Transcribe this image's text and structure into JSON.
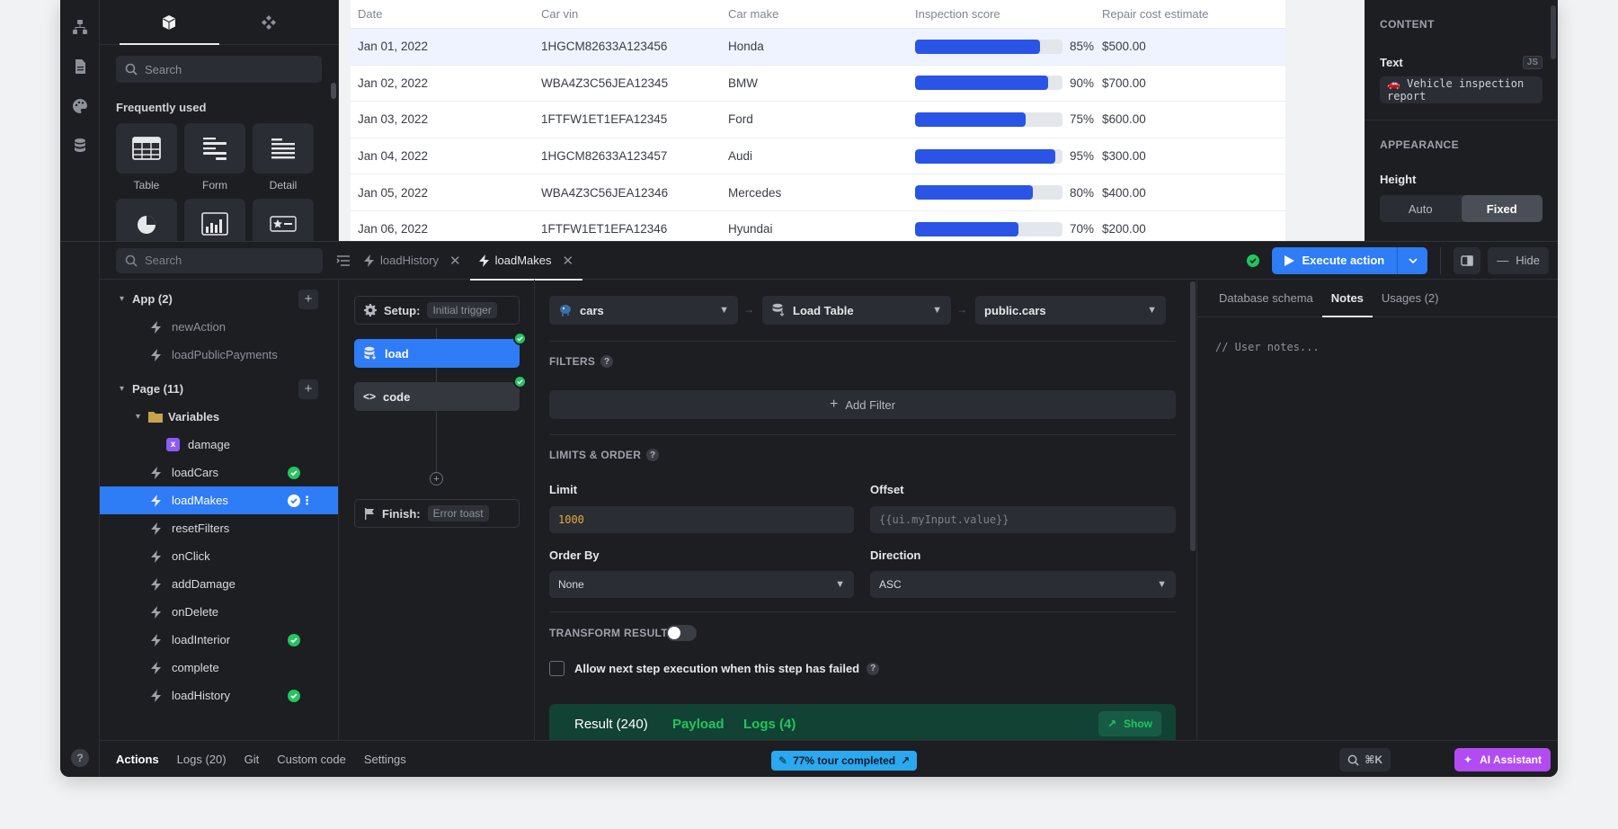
{
  "widgets": {
    "search_placeholder": "Search",
    "section_title": "Frequently used",
    "items": [
      {
        "label": "Table",
        "icon": "table-icon"
      },
      {
        "label": "Form",
        "icon": "form-icon"
      },
      {
        "label": "Detail",
        "icon": "detail-icon"
      },
      {
        "label": "",
        "icon": "pie-chart-icon"
      },
      {
        "label": "",
        "icon": "bar-chart-icon"
      },
      {
        "label": "",
        "icon": "rating-icon"
      }
    ]
  },
  "grid": {
    "columns": [
      "Date",
      "Car vin",
      "Car make",
      "Inspection score",
      "Repair cost estimate"
    ],
    "rows": [
      {
        "date": "Jan 01, 2022",
        "vin": "1HGCM82633A123456",
        "make": "Honda",
        "score": 85,
        "score_label": "85%",
        "cost": "$500.00"
      },
      {
        "date": "Jan 02, 2022",
        "vin": "WBA4Z3C56JEA12345",
        "make": "BMW",
        "score": 90,
        "score_label": "90%",
        "cost": "$700.00"
      },
      {
        "date": "Jan 03, 2022",
        "vin": "1FTFW1ET1EFA12345",
        "make": "Ford",
        "score": 75,
        "score_label": "75%",
        "cost": "$600.00"
      },
      {
        "date": "Jan 04, 2022",
        "vin": "1HGCM82633A123457",
        "make": "Audi",
        "score": 95,
        "score_label": "95%",
        "cost": "$300.00"
      },
      {
        "date": "Jan 05, 2022",
        "vin": "WBA4Z3C56JEA12346",
        "make": "Mercedes",
        "score": 80,
        "score_label": "80%",
        "cost": "$400.00"
      },
      {
        "date": "Jan 06, 2022",
        "vin": "1FTFW1ET1EFA12346",
        "make": "Hyundai",
        "score": 70,
        "score_label": "70%",
        "cost": "$200.00"
      }
    ]
  },
  "props": {
    "content_title": "CONTENT",
    "text_label": "Text",
    "js_badge": "JS",
    "text_value": "🚗 Vehicle inspection report",
    "appearance_title": "APPEARANCE",
    "height_label": "Height",
    "height_auto": "Auto",
    "height_fixed": "Fixed"
  },
  "actions_bar": {
    "search_placeholder": "Search",
    "tabs": [
      {
        "label": "loadHistory",
        "active": false
      },
      {
        "label": "loadMakes",
        "active": true
      }
    ],
    "execute_label": "Execute action",
    "hide_label": "Hide"
  },
  "tree": {
    "app_group": "App (2)",
    "app_items": [
      "newAction",
      "loadPublicPayments"
    ],
    "page_group": "Page (11)",
    "variables_label": "Variables",
    "variable_item": "damage",
    "page_items": [
      {
        "label": "loadCars",
        "status": "ok"
      },
      {
        "label": "loadMakes",
        "status": "selected"
      },
      {
        "label": "resetFilters",
        "status": ""
      },
      {
        "label": "onClick",
        "status": ""
      },
      {
        "label": "addDamage",
        "status": ""
      },
      {
        "label": "onDelete",
        "status": ""
      },
      {
        "label": "loadInterior",
        "status": "ok"
      },
      {
        "label": "complete",
        "status": ""
      },
      {
        "label": "loadHistory",
        "status": "ok"
      }
    ]
  },
  "flow": {
    "setup_label": "Setup:",
    "setup_chip": "Initial trigger",
    "step1": "load",
    "step2": "code",
    "finish_label": "Finish:",
    "finish_chip": "Error toast"
  },
  "editor": {
    "source": "cars",
    "operation": "Load Table",
    "table": "public.cars",
    "filters_title": "FILTERS",
    "add_filter": "Add Filter",
    "limits_title": "LIMITS & ORDER",
    "limit_label": "Limit",
    "limit_value": "1000",
    "offset_label": "Offset",
    "offset_placeholder": "{{ui.myInput.value}}",
    "order_label": "Order By",
    "order_value": "None",
    "direction_label": "Direction",
    "direction_value": "ASC",
    "transform_title": "TRANSFORM RESULT",
    "allow_next_label": "Allow next step execution when this step has failed",
    "result_tab": "Result (240)",
    "payload_tab": "Payload",
    "logs_tab": "Logs (4)",
    "show_label": "Show"
  },
  "notes": {
    "tabs": [
      "Database schema",
      "Notes",
      "Usages (2)"
    ],
    "content": "// User notes..."
  },
  "status_bar": {
    "tabs": [
      "Actions",
      "Logs (20)",
      "Git",
      "Custom code",
      "Settings"
    ],
    "tour": "77% tour completed",
    "shortcut": "⌘K",
    "ai_label": "AI Assistant"
  },
  "colors": {
    "accent": "#2e7cf6",
    "success": "#22c55e",
    "score_bar": "#2a54e5",
    "ai": "#b34bf2",
    "tour": "#2aa8f0"
  }
}
